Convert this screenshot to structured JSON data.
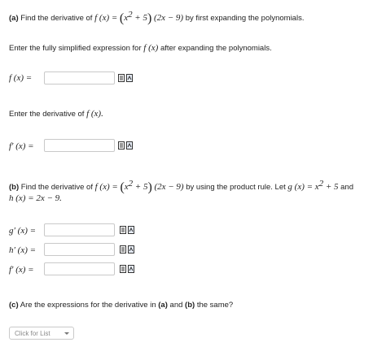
{
  "part_a": {
    "label": "(a)",
    "prompt_before": "Find the derivative of",
    "fx": "f (x) =",
    "expr_1": "x",
    "exp": "2",
    "expr_2": "+ 5",
    "expr_3": "(2x − 9)",
    "prompt_after": "by first expanding the polynomials.",
    "enter_fx_text": "Enter the fully simplified expression for",
    "enter_fx_math": "f (x)",
    "enter_fx_after": "after expanding the polynomials.",
    "fx_label": "f (x) =",
    "fx_value": "",
    "enter_deriv_text": "Enter the derivative of",
    "enter_deriv_math": "f (x).",
    "fpx_label": "f′ (x) =",
    "fpx_value": ""
  },
  "part_b": {
    "label": "(b)",
    "prompt_before": "Find the derivative of",
    "fx": "f (x) =",
    "expr_1": "x",
    "exp": "2",
    "expr_2": "+ 5",
    "expr_3": "(2x − 9)",
    "prompt_mid": "by using the product rule. Let",
    "gx": "g (x) = x",
    "gexp": "2",
    "gtail": "+ 5",
    "and": "and",
    "hx": "h (x) = 2x − 9.",
    "gpx_label": "g′ (x) =",
    "hpx_label": "h′ (x) =",
    "fpx_label": "f′ (x) =",
    "gpx_value": "",
    "hpx_value": "",
    "fpx_value": ""
  },
  "part_c": {
    "label": "(c)",
    "question": "Are the expressions for the derivative in",
    "a_ref": "(a)",
    "and_word": "and",
    "b_ref": "(b)",
    "tail": "the same?",
    "dropdown_placeholder": "Click for List"
  },
  "icons": [
    "preview-icon",
    "formula-help-icon"
  ]
}
